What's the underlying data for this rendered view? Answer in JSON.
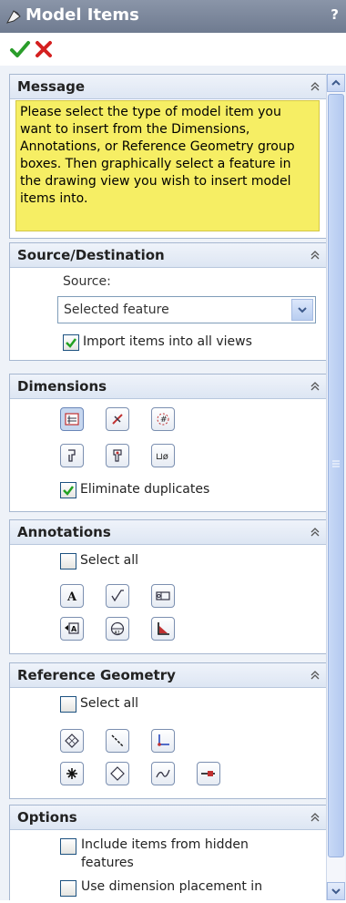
{
  "window": {
    "title": "Model Items",
    "help": "?"
  },
  "message": {
    "title": "Message",
    "text": "Please select the type of model item you want to insert from the Dimensions, Annotations, or Reference Geometry group boxes. Then graphically select a feature in the drawing view you wish to insert model items into."
  },
  "source": {
    "title": "Source/Destination",
    "source_label": "Source:",
    "source_value": "Selected feature",
    "import_label": "Import items into all views",
    "import_checked": true
  },
  "dimensions": {
    "title": "Dimensions",
    "eliminate_label": "Eliminate duplicates",
    "eliminate_checked": true
  },
  "annotations": {
    "title": "Annotations",
    "select_all_label": "Select all",
    "select_all_checked": false
  },
  "refgeom": {
    "title": "Reference Geometry",
    "select_all_label": "Select all",
    "select_all_checked": false
  },
  "options": {
    "title": "Options",
    "hidden_label_1": "Include items from hidden",
    "hidden_label_2": "features",
    "placement_label": "Use dimension placement in"
  },
  "colors": {
    "titlebar": "#7a8599",
    "message_bg": "#f6ee64",
    "group_border": "#a6b7d0",
    "ok": "#2a9d2a",
    "cancel": "#d42020"
  }
}
